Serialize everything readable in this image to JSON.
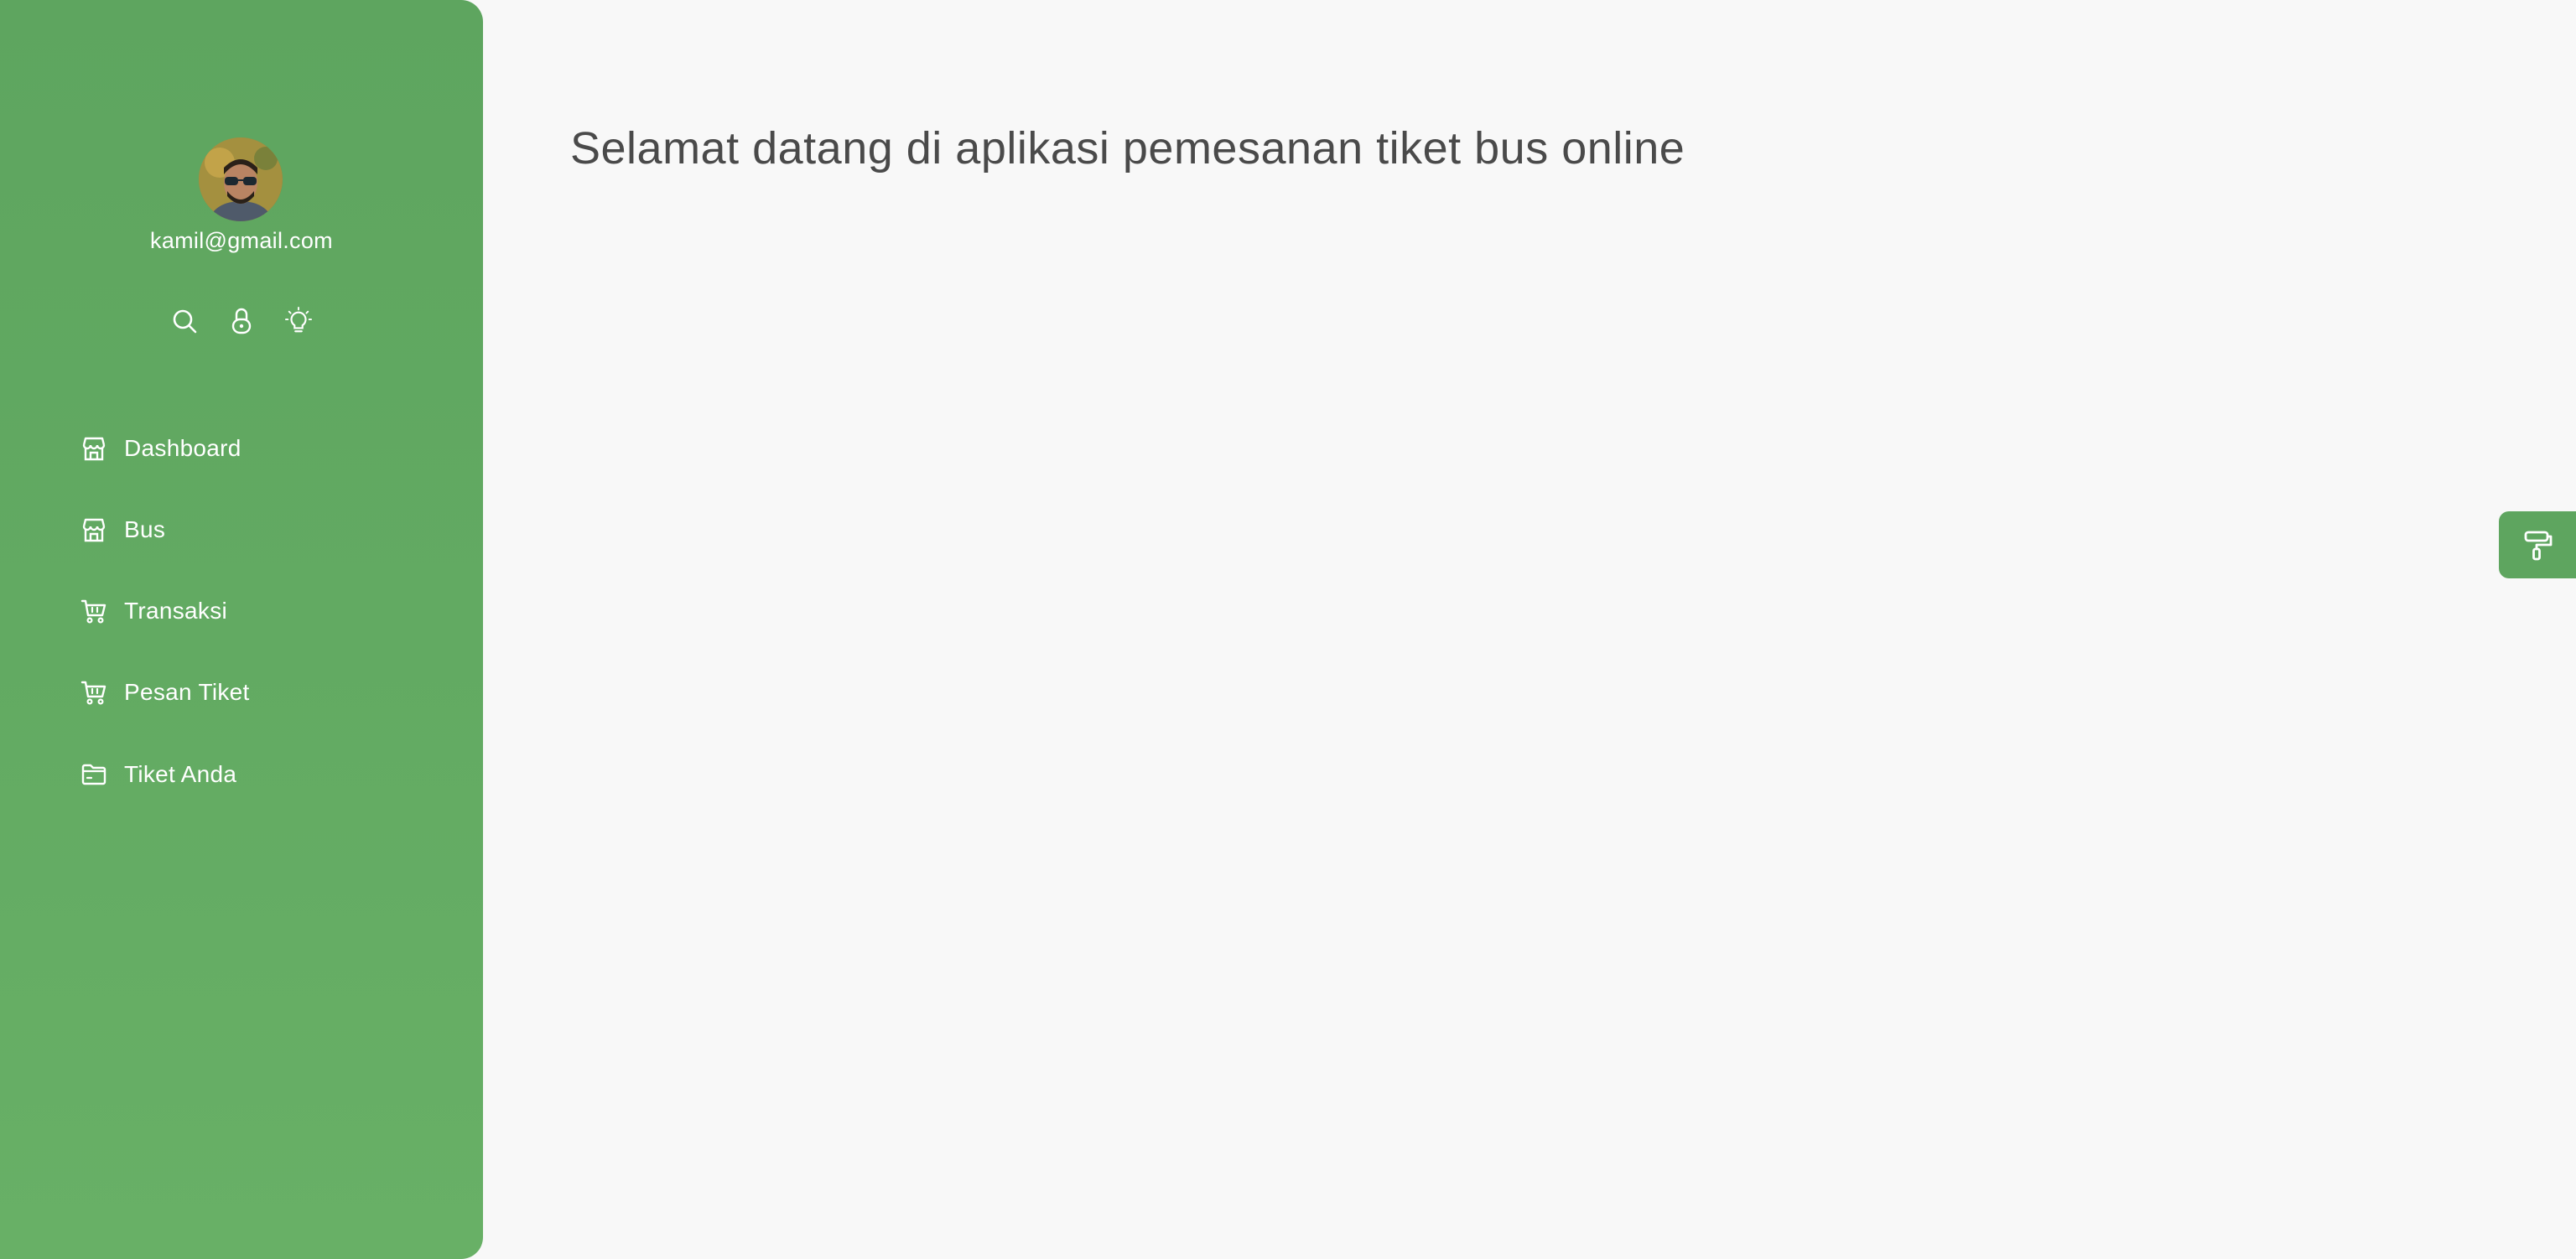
{
  "user": {
    "email": "kamil@gmail.com"
  },
  "quick_actions": [
    {
      "icon": "search-icon"
    },
    {
      "icon": "lock-icon"
    },
    {
      "icon": "lightbulb-icon"
    }
  ],
  "sidebar": {
    "items": [
      {
        "label": "Dashboard",
        "icon": "store-icon"
      },
      {
        "label": "Bus",
        "icon": "store-icon"
      },
      {
        "label": "Transaksi",
        "icon": "cart-icon"
      },
      {
        "label": "Pesan Tiket",
        "icon": "cart-icon"
      },
      {
        "label": "Tiket Anda",
        "icon": "folder-icon"
      }
    ]
  },
  "main": {
    "title": "Selamat datang di aplikasi pemesanan tiket bus online"
  },
  "theme": {
    "accent": "#5ea55f",
    "background": "#f8f8f8",
    "title_color": "#4a4a4a",
    "customizer_icon": "paint-roller-icon"
  }
}
